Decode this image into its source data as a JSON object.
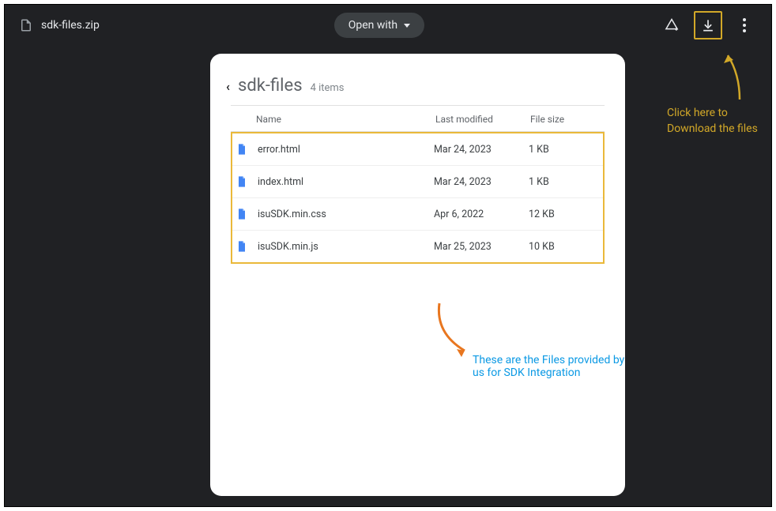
{
  "topbar": {
    "title": "sdk-files.zip",
    "open_with_label": "Open with"
  },
  "preview": {
    "folder_name": "sdk-files",
    "item_count_label": "4 items",
    "columns": {
      "name": "Name",
      "modified": "Last modified",
      "size": "File size"
    },
    "files": [
      {
        "name": "error.html",
        "modified": "Mar 24, 2023",
        "size": "1 KB"
      },
      {
        "name": "index.html",
        "modified": "Mar 24, 2023",
        "size": "1 KB"
      },
      {
        "name": "isuSDK.min.css",
        "modified": "Apr 6, 2022",
        "size": "12 KB"
      },
      {
        "name": "isuSDK.min.js",
        "modified": "Mar 25, 2023",
        "size": "10 KB"
      }
    ]
  },
  "annotations": {
    "blue": "These are the Files provided by us for SDK Integration",
    "yellow": "Click here to Download the files"
  }
}
